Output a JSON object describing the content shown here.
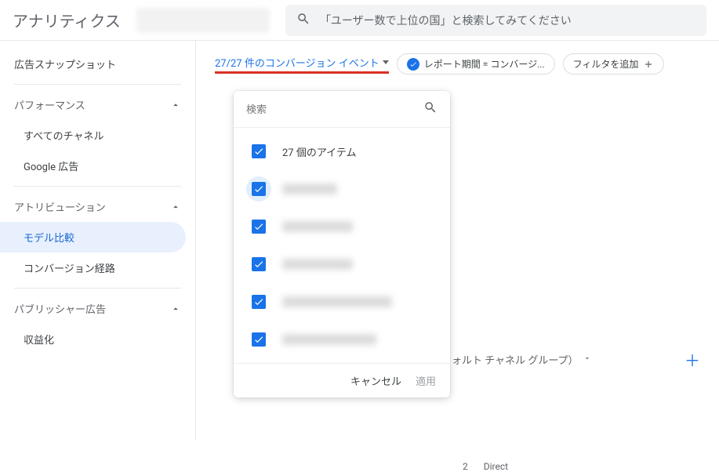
{
  "header": {
    "app_title": "アナリティクス",
    "search_placeholder": "「ユーザー数で上位の国」と検索してみてください"
  },
  "sidebar": {
    "snapshot": "広告スナップショット",
    "performance": {
      "label": "パフォーマンス",
      "items": [
        "すべてのチャネル",
        "Google 広告"
      ]
    },
    "attribution": {
      "label": "アトリビューション",
      "items": [
        "モデル比較",
        "コンバージョン経路"
      ]
    },
    "publisher": {
      "label": "パブリッシャー広告",
      "items": [
        "収益化"
      ]
    }
  },
  "controls": {
    "conversion_trigger": "27/27 件のコンバージョン イベント",
    "chip_report_period": "レポート期間 = コンバージ...",
    "chip_add_filter": "フィルタを追加"
  },
  "popup": {
    "search_placeholder": "検索",
    "all_items": "27 個のアイテム",
    "items_blur_widths": [
      70,
      90,
      90,
      140,
      120,
      90,
      120
    ],
    "cancel": "キャンセル",
    "apply": "適用"
  },
  "secondary": {
    "dimension_label": "デフォルト チャネル グループ）"
  },
  "row_hint": {
    "index": "2",
    "value": "Direct"
  }
}
